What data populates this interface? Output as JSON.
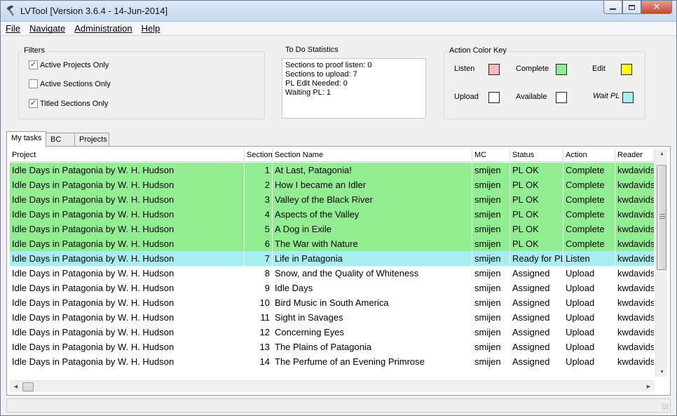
{
  "window": {
    "title": "LVTool [Version 3.6.4 - 14-Jun-2014]",
    "minimize_label": "▭",
    "restore_label": "❐",
    "close_label": "✕"
  },
  "menu": [
    "File",
    "Navigate",
    "Administration",
    "Help"
  ],
  "filters": {
    "title": "Filters",
    "options": [
      {
        "label": "Active Projects Only",
        "checked": true
      },
      {
        "label": "Active Sections Only",
        "checked": false
      },
      {
        "label": "Titled Sections Only",
        "checked": true
      }
    ]
  },
  "todo": {
    "title": "To Do Statistics",
    "lines": [
      "Sections to proof listen: 0",
      "Sections to upload: 7",
      "PL Edit Needed: 0",
      "Waiting PL: 1"
    ]
  },
  "color_key": {
    "title": "Action Color Key",
    "items": [
      {
        "label": "Listen",
        "color": "#f9b8c0"
      },
      {
        "label": "Complete",
        "color": "#90ee90"
      },
      {
        "label": "Edit",
        "color": "#ffff00"
      },
      {
        "label": "Upload",
        "color": "#ffffff"
      },
      {
        "label": "Available",
        "color": "#ffffff"
      },
      {
        "label": "Wait PL",
        "color": "#a6eef0"
      }
    ]
  },
  "tabs": [
    {
      "label": "My tasks",
      "active": true
    },
    {
      "label": "BC",
      "active": false
    },
    {
      "label": "Projects",
      "active": false
    }
  ],
  "table": {
    "columns": [
      "Project",
      "Section",
      "Section Name",
      "MC",
      "Status",
      "Action",
      "Reader"
    ],
    "rows": [
      {
        "project": "Idle Days in Patagonia by W. H. Hudson",
        "section": "1",
        "name": "At Last, Patagonia!",
        "mc": "smijen",
        "status": "PL OK",
        "action": "Complete",
        "reader": "kwdavids",
        "color": "#90ee90"
      },
      {
        "project": "Idle Days in Patagonia by W. H. Hudson",
        "section": "2",
        "name": "How I became an Idler",
        "mc": "smijen",
        "status": "PL OK",
        "action": "Complete",
        "reader": "kwdavids",
        "color": "#90ee90"
      },
      {
        "project": "Idle Days in Patagonia by W. H. Hudson",
        "section": "3",
        "name": "Valley of the Black River",
        "mc": "smijen",
        "status": "PL OK",
        "action": "Complete",
        "reader": "kwdavids",
        "color": "#90ee90"
      },
      {
        "project": "Idle Days in Patagonia by W. H. Hudson",
        "section": "4",
        "name": "Aspects of the Valley",
        "mc": "smijen",
        "status": "PL OK",
        "action": "Complete",
        "reader": "kwdavids",
        "color": "#90ee90"
      },
      {
        "project": "Idle Days in Patagonia by W. H. Hudson",
        "section": "5",
        "name": "A Dog in Exile",
        "mc": "smijen",
        "status": "PL OK",
        "action": "Complete",
        "reader": "kwdavids",
        "color": "#90ee90"
      },
      {
        "project": "Idle Days in Patagonia by W. H. Hudson",
        "section": "6",
        "name": "The War with Nature",
        "mc": "smijen",
        "status": "PL OK",
        "action": "Complete",
        "reader": "kwdavids",
        "color": "#90ee90"
      },
      {
        "project": "Idle Days in Patagonia by W. H. Hudson",
        "section": "7",
        "name": "Life in Patagonia",
        "mc": "smijen",
        "status": "Ready for PL",
        "action": "Listen",
        "reader": "kwdavids",
        "color": "#a6eef0"
      },
      {
        "project": "Idle Days in Patagonia by W. H. Hudson",
        "section": "8",
        "name": "Snow, and the Quality of Whiteness",
        "mc": "smijen",
        "status": "Assigned",
        "action": "Upload",
        "reader": "kwdavids",
        "color": "#ffffff"
      },
      {
        "project": "Idle Days in Patagonia by W. H. Hudson",
        "section": "9",
        "name": "Idle Days",
        "mc": "smijen",
        "status": "Assigned",
        "action": "Upload",
        "reader": "kwdavids",
        "color": "#ffffff"
      },
      {
        "project": "Idle Days in Patagonia by W. H. Hudson",
        "section": "10",
        "name": "Bird Music in South America",
        "mc": "smijen",
        "status": "Assigned",
        "action": "Upload",
        "reader": "kwdavids",
        "color": "#ffffff"
      },
      {
        "project": "Idle Days in Patagonia by W. H. Hudson",
        "section": "11",
        "name": "Sight in Savages",
        "mc": "smijen",
        "status": "Assigned",
        "action": "Upload",
        "reader": "kwdavids",
        "color": "#ffffff"
      },
      {
        "project": "Idle Days in Patagonia by W. H. Hudson",
        "section": "12",
        "name": "Concerning Eyes",
        "mc": "smijen",
        "status": "Assigned",
        "action": "Upload",
        "reader": "kwdavids",
        "color": "#ffffff"
      },
      {
        "project": "Idle Days in Patagonia by W. H. Hudson",
        "section": "13",
        "name": "The Plains of Patagonia",
        "mc": "smijen",
        "status": "Assigned",
        "action": "Upload",
        "reader": "kwdavids",
        "color": "#ffffff"
      },
      {
        "project": "Idle Days in Patagonia by W. H. Hudson",
        "section": "14",
        "name": "The Perfume of an Evening Primrose",
        "mc": "smijen",
        "status": "Assigned",
        "action": "Upload",
        "reader": "kwdavids",
        "color": "#ffffff"
      }
    ]
  }
}
